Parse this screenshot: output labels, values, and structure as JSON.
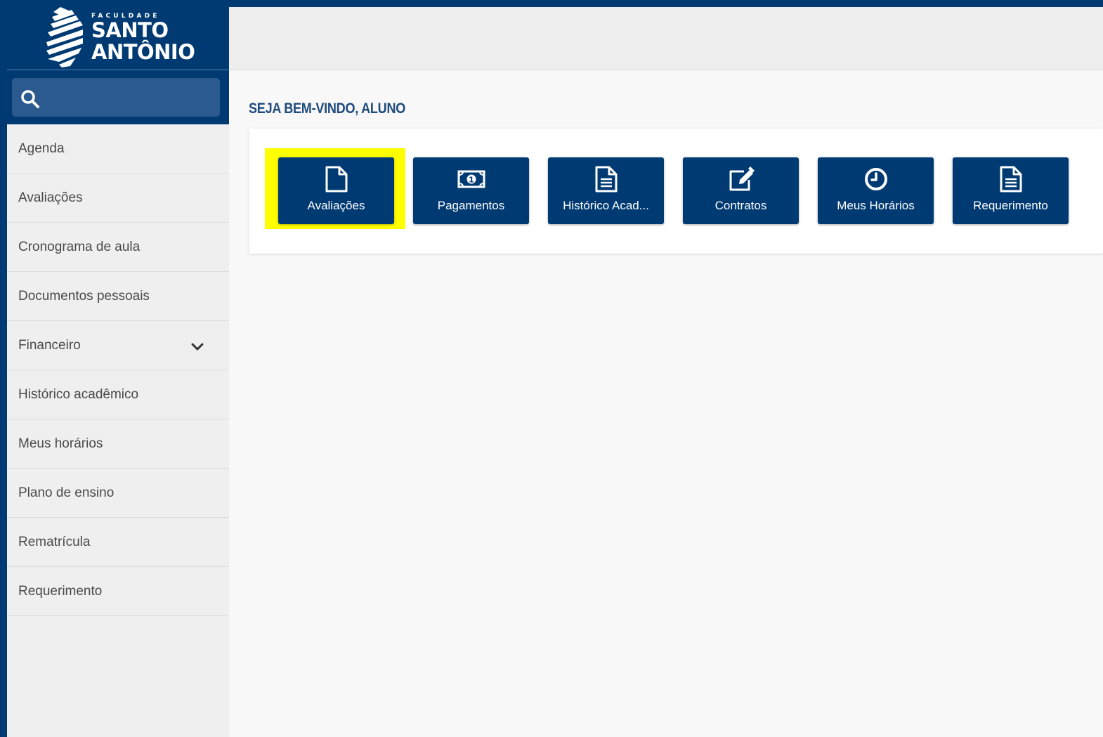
{
  "brand": {
    "small": "FACULDADE",
    "line1": "SANTO",
    "line2": "ANTÔNIO"
  },
  "colors": {
    "primary": "#003a72",
    "highlight": "#ffff00",
    "welcome_text": "#1f4a7c"
  },
  "search": {
    "placeholder": "",
    "icon": "search-icon"
  },
  "sidebar": {
    "items": [
      {
        "label": "Agenda"
      },
      {
        "label": "Avaliações"
      },
      {
        "label": "Cronograma de aula"
      },
      {
        "label": "Documentos pessoais"
      },
      {
        "label": "Financeiro",
        "icon": "chevron-down-icon"
      },
      {
        "label": "Histórico acadêmico"
      },
      {
        "label": "Meus horários"
      },
      {
        "label": "Plano de ensino"
      },
      {
        "label": "Rematrícula"
      },
      {
        "label": "Requerimento"
      }
    ]
  },
  "main": {
    "welcome": "SEJA BEM-VINDO, ALUNO",
    "tiles": [
      {
        "label": "Avaliações",
        "icon": "file-icon",
        "highlighted": true
      },
      {
        "label": "Pagamentos",
        "icon": "money-icon"
      },
      {
        "label": "Histórico Acad...",
        "icon": "document-text-icon"
      },
      {
        "label": "Contratos",
        "icon": "edit-icon"
      },
      {
        "label": "Meus Horários",
        "icon": "clock-icon"
      },
      {
        "label": "Requerimento",
        "icon": "document-text-icon"
      }
    ]
  }
}
